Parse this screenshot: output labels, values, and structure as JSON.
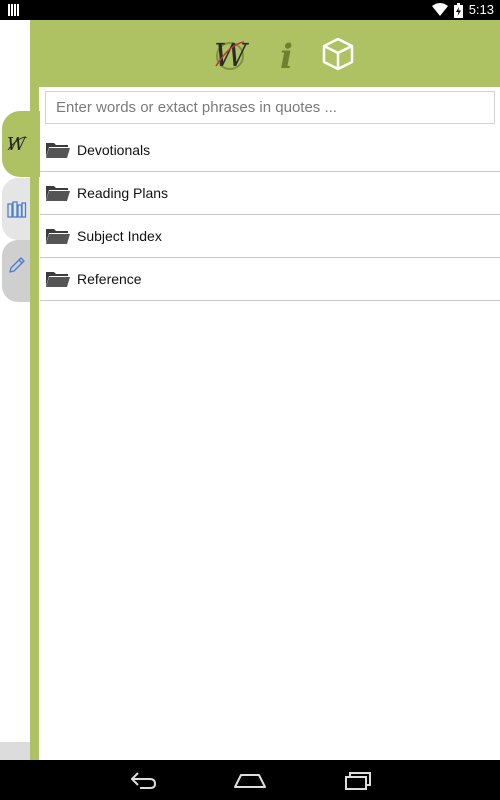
{
  "status_bar": {
    "time": "5:13",
    "icons": [
      "notification-bars-icon",
      "wifi-icon",
      "battery-icon"
    ]
  },
  "header": {
    "icons": [
      "word-logo-icon",
      "info-icon",
      "box-icon"
    ]
  },
  "side_tabs": [
    {
      "name": "word-tab",
      "icon": "word-logo-icon"
    },
    {
      "name": "library-tab",
      "icon": "books-icon"
    },
    {
      "name": "notes-tab",
      "icon": "pencil-icon"
    }
  ],
  "search": {
    "placeholder": "Enter words or extact phrases in quotes ..."
  },
  "list": {
    "items": [
      {
        "label": "Devotionals",
        "icon": "folder-icon"
      },
      {
        "label": "Reading Plans",
        "icon": "folder-icon"
      },
      {
        "label": "Subject Index",
        "icon": "folder-icon"
      },
      {
        "label": "Reference",
        "icon": "folder-icon"
      }
    ]
  },
  "nav_bar": {
    "buttons": [
      "back-icon",
      "home-icon",
      "recents-icon"
    ]
  },
  "colors": {
    "accent": "#afc263",
    "status_bar": "#000000"
  }
}
